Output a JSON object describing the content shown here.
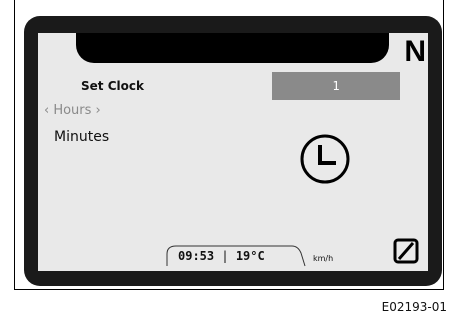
{
  "header": {
    "gear_indicator": "N"
  },
  "menu": {
    "title": "Set Clock",
    "items": [
      {
        "label": "‹ Hours ›",
        "selected": true
      },
      {
        "label": "Minutes",
        "selected": false
      }
    ],
    "value": "1"
  },
  "status_bar": {
    "time": "09:53",
    "separator": "|",
    "temperature": "19°C",
    "speed_unit": "km/h"
  },
  "icons": {
    "clock": "clock-icon",
    "corner": "slashed-zero-icon"
  },
  "figure_code": "E02193-01",
  "colors": {
    "bezel": "#1a1a1a",
    "screen": "#e9e9e9",
    "value_box": "#8a8a8a",
    "selected_text": "#8a8a8a"
  }
}
